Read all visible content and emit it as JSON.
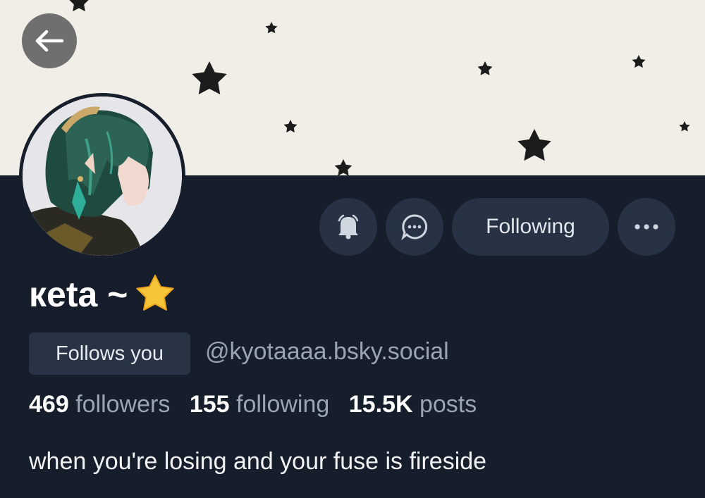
{
  "profile": {
    "display_name": "кеta ~",
    "display_name_emoji": "star-emoji",
    "follows_you_label": "Follows you",
    "handle": "@kyotaaaa.bsky.social",
    "bio": "when you're losing and your fuse is fireside"
  },
  "stats": {
    "followers_count": "469",
    "followers_label": "followers",
    "following_count": "155",
    "following_label": "following",
    "posts_count": "15.5K",
    "posts_label": "posts"
  },
  "actions": {
    "following_label": "Following",
    "notify_icon": "bell-icon",
    "message_icon": "chat-bubble-icon",
    "more_icon": "more-horizontal-icon"
  },
  "nav": {
    "back_icon": "arrow-left-icon"
  },
  "colors": {
    "background": "#161e2b",
    "banner_background": "#f1eee8",
    "button_background": "#273244",
    "muted_text": "#9aa5b4",
    "star_gold": "#f7c53a"
  }
}
